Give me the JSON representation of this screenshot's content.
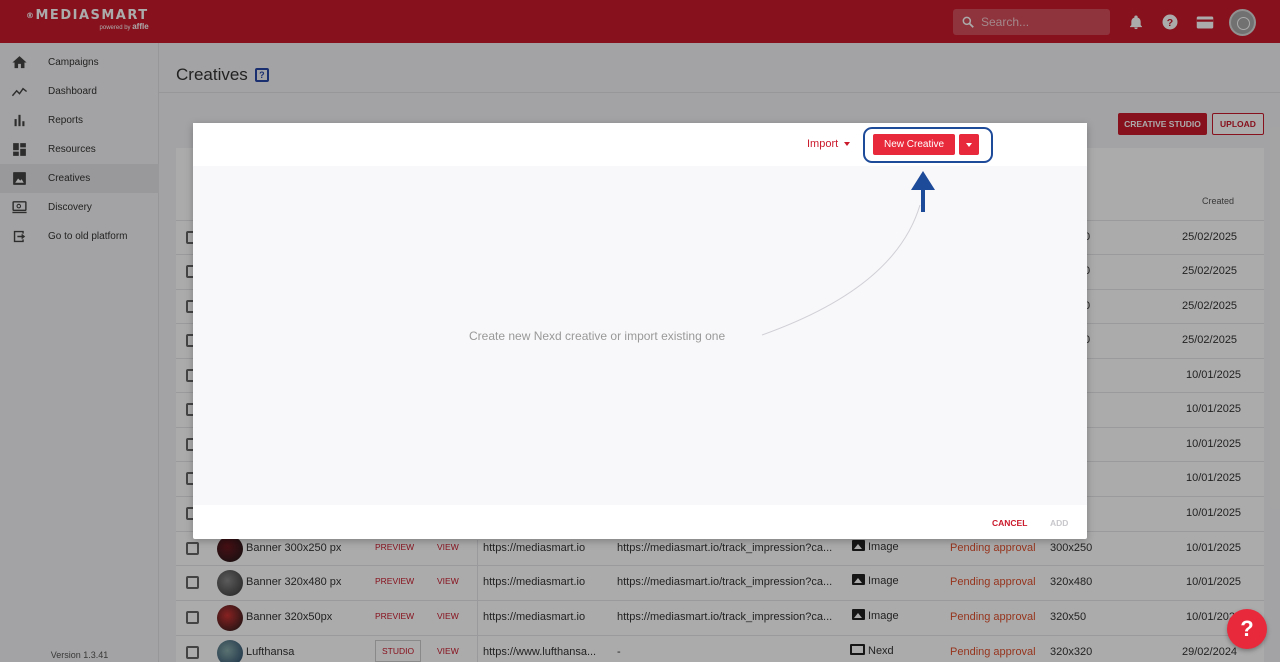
{
  "app": {
    "logo_main": "MEDIASMART",
    "logo_sub_prefix": "powered by",
    "logo_sub_brand": "affle"
  },
  "header": {
    "search_placeholder": "Search..."
  },
  "sidebar": {
    "items": [
      {
        "label": "Campaigns",
        "icon": "home-icon"
      },
      {
        "label": "Dashboard",
        "icon": "trend-icon"
      },
      {
        "label": "Reports",
        "icon": "bar-chart-icon"
      },
      {
        "label": "Resources",
        "icon": "dashboard-icon"
      },
      {
        "label": "Creatives",
        "icon": "image-icon",
        "active": true
      },
      {
        "label": "Discovery",
        "icon": "screen-search-icon"
      },
      {
        "label": "Go to old platform",
        "icon": "exit-icon"
      }
    ],
    "version": "Version 1.3.41"
  },
  "page": {
    "title": "Creatives",
    "help_glyph": "?",
    "creative_studio_label": "CREATIVE STUDIO",
    "upload_label": "UPLOAD",
    "col_created": "Created"
  },
  "table": {
    "hidden_rows": [
      {
        "dim": "0",
        "created": "25/02/2025"
      },
      {
        "dim": "0",
        "created": "25/02/2025"
      },
      {
        "dim": "0",
        "created": "25/02/2025"
      },
      {
        "dim": "0",
        "created": "25/02/2025"
      },
      {
        "dim": "",
        "created": "10/01/2025"
      },
      {
        "dim": "",
        "created": "10/01/2025"
      },
      {
        "dim": "",
        "created": "10/01/2025"
      },
      {
        "dim": "",
        "created": "10/01/2025"
      },
      {
        "dim": "",
        "created": "10/01/2025"
      }
    ],
    "rows": [
      {
        "name": "Banner 300x250 px",
        "action1": "PREVIEW",
        "action2": "VIEW",
        "url": "https://mediasmart.io",
        "tracking": "https://mediasmart.io/track_impression?ca...",
        "type": "Image",
        "status": "Pending approval",
        "size": "300x250",
        "created": "10/01/2025"
      },
      {
        "name": "Banner 320x480 px",
        "action1": "PREVIEW",
        "action2": "VIEW",
        "url": "https://mediasmart.io",
        "tracking": "https://mediasmart.io/track_impression?ca...",
        "type": "Image",
        "status": "Pending approval",
        "size": "320x480",
        "created": "10/01/2025"
      },
      {
        "name": "Banner 320x50px",
        "action1": "PREVIEW",
        "action2": "VIEW",
        "url": "https://mediasmart.io",
        "tracking": "https://mediasmart.io/track_impression?ca...",
        "type": "Image",
        "status": "Pending approval",
        "size": "320x50",
        "created": "10/01/2024"
      },
      {
        "name": "Lufthansa",
        "action1": "STUDIO",
        "action2": "VIEW",
        "url": "https://www.lufthansa...",
        "tracking": "-",
        "type": "Nexd",
        "status": "Pending approval",
        "size": "320x320",
        "created": "29/02/2024"
      }
    ]
  },
  "modal": {
    "import_label": "Import",
    "new_creative_label": "New Creative",
    "empty_text": "Create new Nexd creative or import existing one",
    "cancel_label": "CANCEL",
    "add_label": "ADD"
  },
  "help_fab": "?",
  "colors": {
    "brand": "#ca1a2c",
    "button": "#e8283b",
    "annotation": "#1e4a9a",
    "pending": "#e0502e"
  }
}
